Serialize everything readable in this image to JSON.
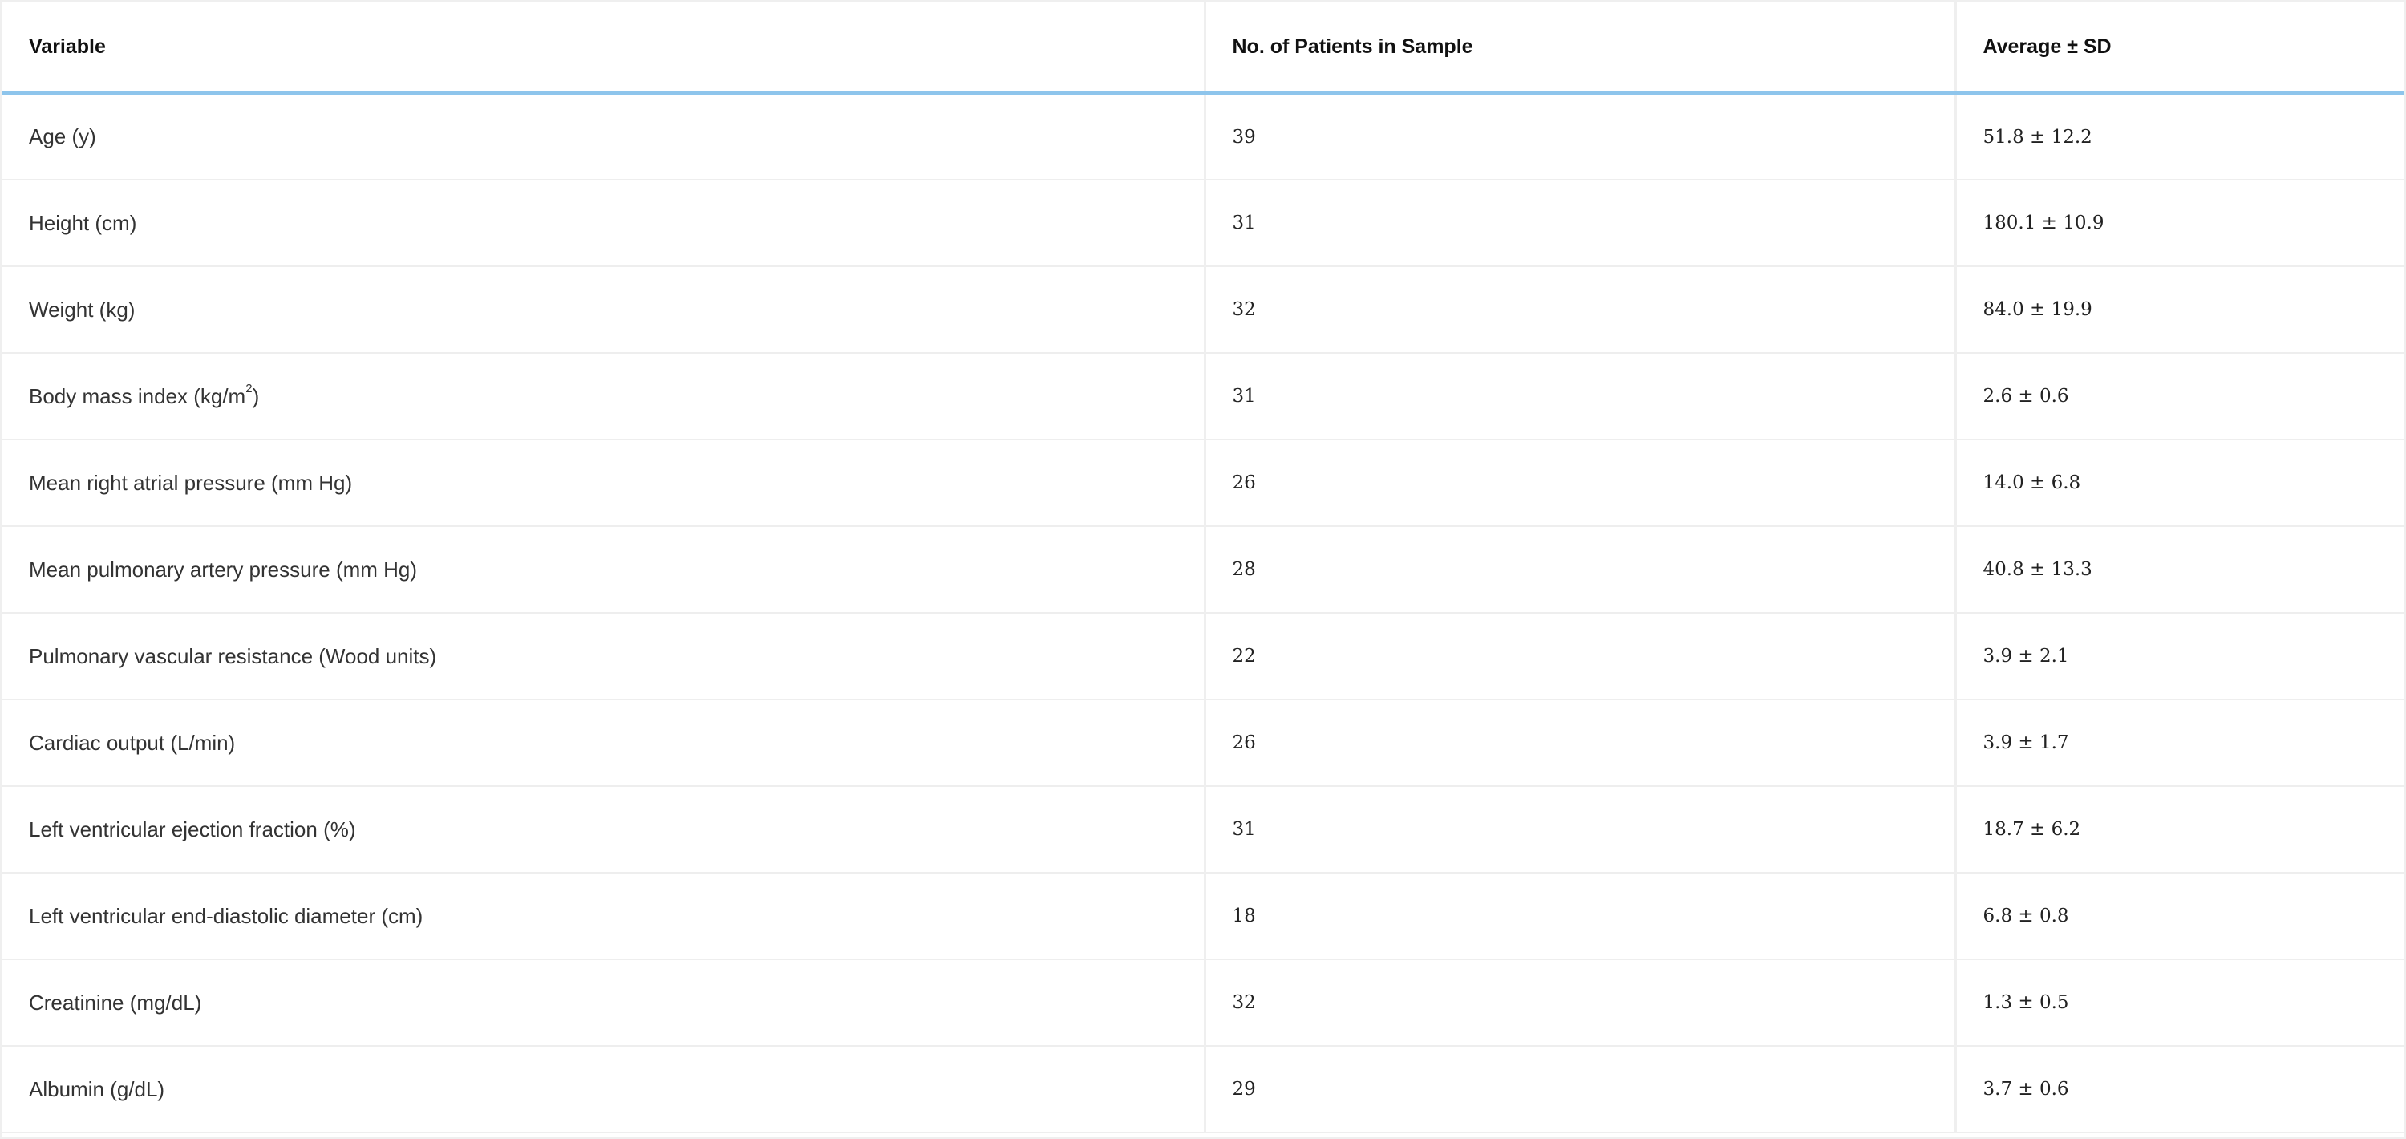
{
  "table": {
    "headers": [
      "Variable",
      "No. of Patients in Sample",
      "Average ± SD"
    ],
    "rows": [
      {
        "variable": "Age (y)",
        "n": "39",
        "avg": "51.8 ± 12.2"
      },
      {
        "variable": "Height (cm)",
        "n": "31",
        "avg": "180.1 ± 10.9"
      },
      {
        "variable": "Weight (kg)",
        "n": "32",
        "avg": "84.0 ± 19.9"
      },
      {
        "variable": "Body mass index (kg/m",
        "variable_sup": "2",
        "variable_suffix": ")",
        "n": "31",
        "avg": "2.6 ± 0.6"
      },
      {
        "variable": "Mean right atrial pressure (mm Hg)",
        "n": "26",
        "avg": "14.0 ± 6.8"
      },
      {
        "variable": "Mean pulmonary artery pressure (mm Hg)",
        "n": "28",
        "avg": "40.8 ± 13.3"
      },
      {
        "variable": "Pulmonary vascular resistance (Wood units)",
        "n": "22",
        "avg": "3.9 ± 2.1"
      },
      {
        "variable": "Cardiac output (L/min)",
        "n": "26",
        "avg": "3.9 ± 1.7"
      },
      {
        "variable": "Left ventricular ejection fraction (%)",
        "n": "31",
        "avg": "18.7 ± 6.2"
      },
      {
        "variable": "Left ventricular end-diastolic diameter (cm)",
        "n": "18",
        "avg": "6.8 ± 0.8"
      },
      {
        "variable": "Creatinine (mg/dL)",
        "n": "32",
        "avg": "1.3 ± 0.5"
      },
      {
        "variable": "Albumin (g/dL)",
        "n": "29",
        "avg": "3.7 ± 0.6"
      }
    ]
  },
  "colors": {
    "header_rule": "#8ec5ec",
    "grid": "#efefef",
    "text": "#333333"
  }
}
